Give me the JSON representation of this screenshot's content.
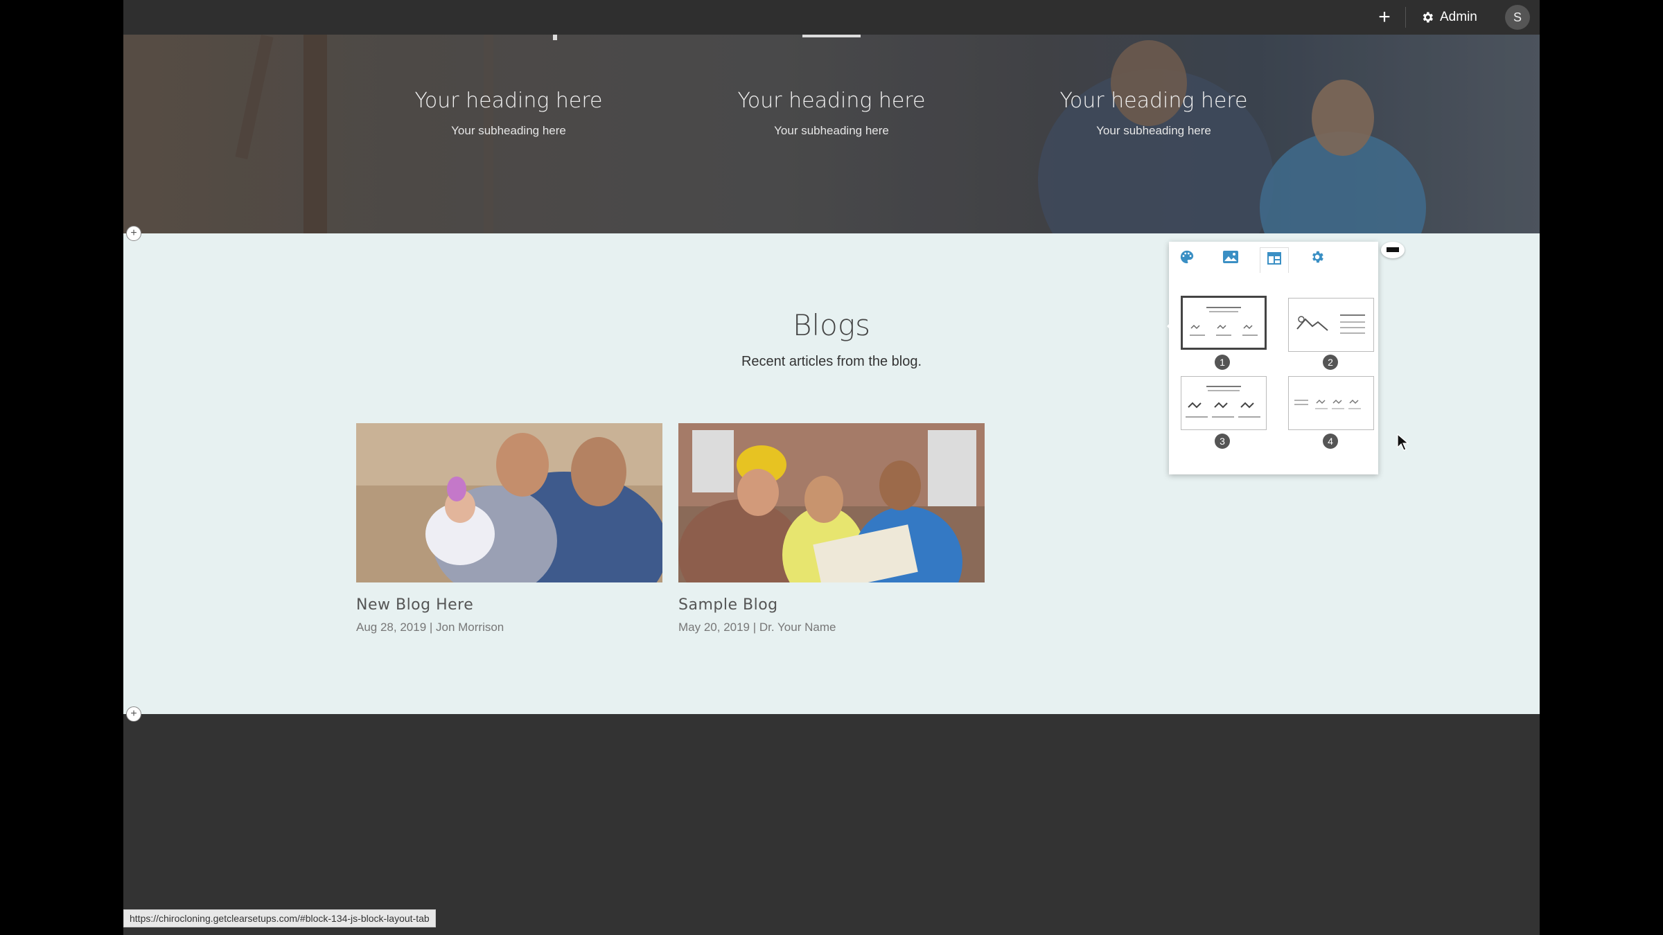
{
  "topbar": {
    "add_icon": "plus-icon",
    "admin_label": "Admin",
    "avatar_initial": "S"
  },
  "hero": {
    "columns": [
      {
        "heading": "Your heading here",
        "subheading": "Your subheading here"
      },
      {
        "heading": "Your heading here",
        "subheading": "Your subheading here"
      },
      {
        "heading": "Your heading here",
        "subheading": "Your subheading here"
      }
    ]
  },
  "blogs": {
    "title": "Blogs",
    "subtitle": "Recent articles from the blog.",
    "posts": [
      {
        "title": "New Blog Here",
        "meta": "Aug 28, 2019 | Jon Morrison"
      },
      {
        "title": "Sample Blog",
        "meta": "May 20, 2019 | Dr. Your Name"
      }
    ]
  },
  "panel": {
    "tabs": [
      "palette-icon",
      "image-icon",
      "layout-icon",
      "gear-icon"
    ],
    "active_tab": "layout-icon",
    "layouts": [
      {
        "number": "1",
        "selected": true
      },
      {
        "number": "2",
        "selected": false
      },
      {
        "number": "3",
        "selected": false
      },
      {
        "number": "4",
        "selected": false
      }
    ]
  },
  "status_bar": {
    "url": "https://chirocloning.getclearsetups.com/#block-134-js-block-layout-tab"
  }
}
